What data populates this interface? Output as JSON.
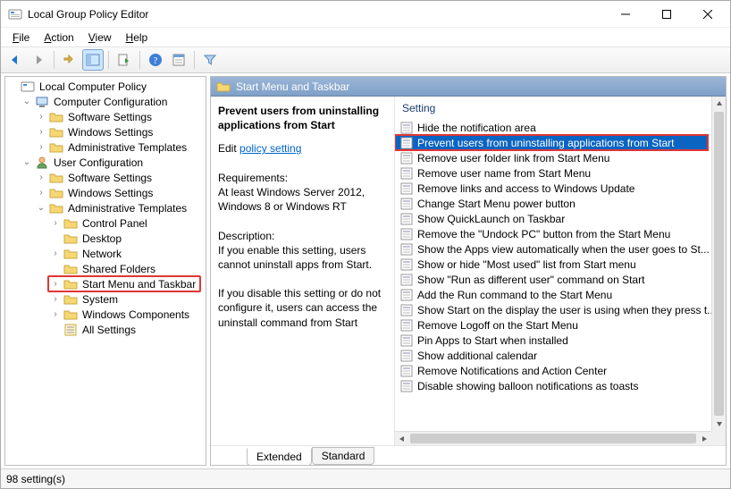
{
  "window": {
    "title": "Local Group Policy Editor"
  },
  "menu": {
    "file": "File",
    "action": "Action",
    "view": "View",
    "help": "Help"
  },
  "tree": {
    "root": "Local Computer Policy",
    "computer": "Computer Configuration",
    "comp_children": [
      "Software Settings",
      "Windows Settings",
      "Administrative Templates"
    ],
    "user": "User Configuration",
    "user_ss": "Software Settings",
    "user_ws": "Windows Settings",
    "user_at": "Administrative Templates",
    "at_children": [
      "Control Panel",
      "Desktop",
      "Network",
      "Shared Folders",
      "Start Menu and Taskbar",
      "System",
      "Windows Components",
      "All Settings"
    ]
  },
  "right": {
    "header": "Start Menu and Taskbar",
    "policy_title": "Prevent users from uninstalling applications from Start",
    "edit_label": "Edit",
    "edit_link": "policy setting",
    "req_label": "Requirements:",
    "req_text": "At least Windows Server 2012, Windows 8 or Windows RT",
    "desc_label": "Description:",
    "desc_text1": "If you enable this setting, users cannot uninstall apps from Start.",
    "desc_text2": "If you disable this setting or do not configure it, users can access the uninstall command from Start",
    "setting_header": "Setting",
    "settings": [
      "Hide the notification area",
      "Prevent users from uninstalling applications from Start",
      "Remove user folder link from Start Menu",
      "Remove user name from Start Menu",
      "Remove links and access to Windows Update",
      "Change Start Menu power button",
      "Show QuickLaunch on Taskbar",
      "Remove the \"Undock PC\" button from the Start Menu",
      "Show the Apps view automatically when the user goes to St...",
      "Show or hide \"Most used\" list from Start menu",
      "Show \"Run as different user\" command on Start",
      "Add the Run command to the Start Menu",
      "Show Start on the display the user is using when they press t...",
      "Remove Logoff on the Start Menu",
      "Pin Apps to Start when installed",
      "Show additional calendar",
      "Remove Notifications and Action Center",
      "Disable showing balloon notifications as toasts"
    ],
    "selected_index": 1,
    "tabs": {
      "extended": "Extended",
      "standard": "Standard"
    }
  },
  "status": "98 setting(s)"
}
